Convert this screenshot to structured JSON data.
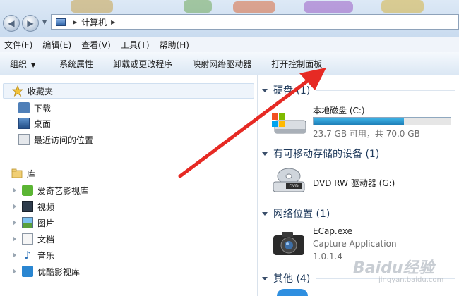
{
  "address_bar": {
    "segments": [
      "计算机"
    ]
  },
  "menu": {
    "items": [
      "文件(F)",
      "编辑(E)",
      "查看(V)",
      "工具(T)",
      "帮助(H)"
    ]
  },
  "toolbar": {
    "organize_label": "组织",
    "items": [
      "系统属性",
      "卸载或更改程序",
      "映射网络驱动器",
      "打开控制面板"
    ]
  },
  "nav": {
    "favorites": {
      "label": "收藏夹",
      "items": [
        "下载",
        "桌面",
        "最近访问的位置"
      ]
    },
    "libraries": {
      "label": "库",
      "items": [
        "爱奇艺影视库",
        "视频",
        "图片",
        "文档",
        "音乐",
        "优酷影视库"
      ]
    }
  },
  "content": {
    "hard_disks": {
      "header": "硬盘 (1)",
      "drives": [
        {
          "name": "本地磁盘 (C:)",
          "usage_text": "23.7 GB 可用，共 70.0 GB",
          "used_fraction": 0.66
        }
      ]
    },
    "removable": {
      "header": "有可移动存储的设备 (1)",
      "drives": [
        {
          "name": "DVD RW 驱动器 (G:)",
          "disc_label": "DVD"
        }
      ]
    },
    "network": {
      "header": "网络位置 (1)",
      "items": [
        {
          "name": "ECap.exe",
          "description": "Capture Application",
          "version": "1.0.1.4"
        }
      ]
    },
    "other": {
      "header": "其他 (4)"
    }
  },
  "watermark": {
    "brand": "Baidu经验",
    "url": "jingyan.baidu.com"
  },
  "colors": {
    "annotation_arrow": "#e62a24",
    "capacity_bar": "#2a9fd8",
    "section_header": "#1e395b"
  }
}
